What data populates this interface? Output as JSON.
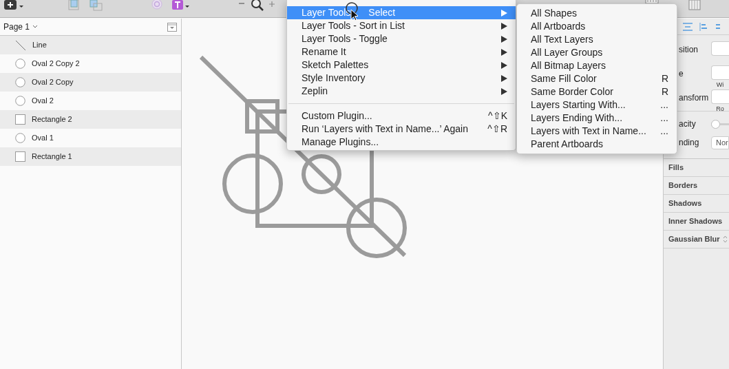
{
  "layers_panel": {
    "page": "Page 1",
    "layers": [
      {
        "name": "Line",
        "kind": "line"
      },
      {
        "name": "Oval 2 Copy 2",
        "kind": "oval"
      },
      {
        "name": "Oval 2 Copy",
        "kind": "oval"
      },
      {
        "name": "Oval 2",
        "kind": "oval"
      },
      {
        "name": "Rectangle 2",
        "kind": "rectangle"
      },
      {
        "name": "Oval 1",
        "kind": "oval"
      },
      {
        "name": "Rectangle 1",
        "kind": "rectangle"
      }
    ]
  },
  "plugins_menu": {
    "items": [
      {
        "kind": "item",
        "label": "Layer Tools",
        "label_after_cursor": "Select",
        "submenu": true,
        "selected": true
      },
      {
        "kind": "item",
        "label": "Layer Tools - Sort in List",
        "submenu": true,
        "selected": false
      },
      {
        "kind": "item",
        "label": "Layer Tools - Toggle",
        "submenu": true,
        "selected": false
      },
      {
        "kind": "item",
        "label": "Rename It",
        "submenu": true,
        "selected": false
      },
      {
        "kind": "item",
        "label": "Sketch Palettes",
        "submenu": true,
        "selected": false
      },
      {
        "kind": "item",
        "label": "Style Inventory",
        "submenu": true,
        "selected": false
      },
      {
        "kind": "item",
        "label": "Zeplin",
        "submenu": true,
        "selected": false
      },
      {
        "kind": "separator"
      },
      {
        "kind": "item",
        "label": "Custom Plugin...",
        "shortcut": "^⇧K",
        "submenu": false,
        "selected": false
      },
      {
        "kind": "item",
        "label": "Run ‘Layers with Text in Name...’ Again",
        "shortcut": "^⇧R",
        "submenu": false,
        "selected": false
      },
      {
        "kind": "item",
        "label": "Manage Plugins...",
        "submenu": false,
        "selected": false
      }
    ]
  },
  "submenu": {
    "items": [
      {
        "label": "All Shapes"
      },
      {
        "label": "All Artboards"
      },
      {
        "label": "All Text Layers"
      },
      {
        "label": "All Layer Groups"
      },
      {
        "label": "All Bitmap Layers"
      },
      {
        "label": "Same Fill Color",
        "shortcut": "R"
      },
      {
        "label": "Same Border Color",
        "shortcut": "R"
      },
      {
        "label": "Layers Starting With...",
        "shortcut": "..."
      },
      {
        "label": "Layers Ending With...",
        "shortcut": "..."
      },
      {
        "label": "Layers with Text in Name...",
        "shortcut": "..."
      },
      {
        "label": "Parent Artboards"
      }
    ]
  },
  "inspector": {
    "fields": [
      {
        "label": "sition"
      },
      {
        "label": "e",
        "caption": "Wi"
      },
      {
        "label": "ansform",
        "caption": "Ro"
      }
    ],
    "opacity": {
      "label": "acity",
      "level": 0
    },
    "blending": {
      "label": "nding",
      "value": "Nor"
    },
    "sections": [
      "Fills",
      "Borders",
      "Shadows",
      "Inner Shadows",
      "Gaussian Blur"
    ]
  }
}
